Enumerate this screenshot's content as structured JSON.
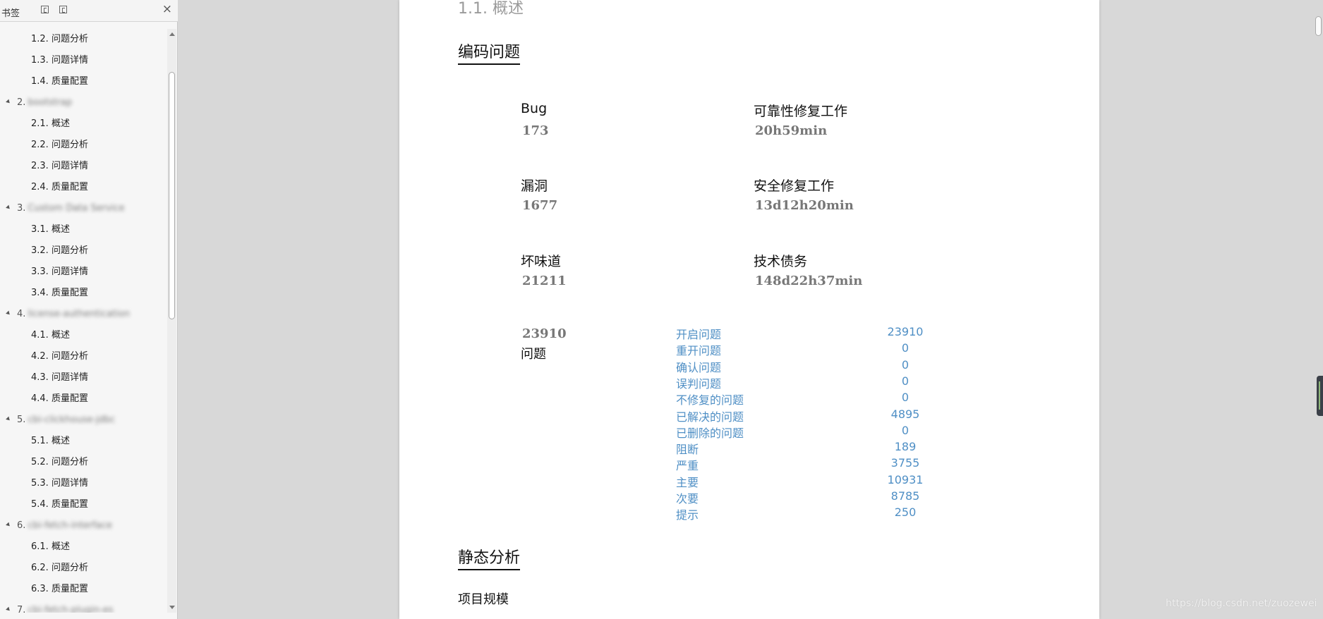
{
  "sidebar": {
    "title": "书签",
    "close_glyph": "×",
    "items": [
      {
        "level": 2,
        "label": "1.2. 问题分析"
      },
      {
        "level": 2,
        "label": "1.3. 问题详情"
      },
      {
        "level": 2,
        "label": "1.4. 质量配置"
      },
      {
        "level": 1,
        "label": "2.",
        "blurred": "bootstrap"
      },
      {
        "level": 2,
        "label": "2.1. 概述"
      },
      {
        "level": 2,
        "label": "2.2. 问题分析"
      },
      {
        "level": 2,
        "label": "2.3. 问题详情"
      },
      {
        "level": 2,
        "label": "2.4. 质量配置"
      },
      {
        "level": 1,
        "label": "3.",
        "blurred": "Custom Data Service"
      },
      {
        "level": 2,
        "label": "3.1. 概述"
      },
      {
        "level": 2,
        "label": "3.2. 问题分析"
      },
      {
        "level": 2,
        "label": "3.3. 问题详情"
      },
      {
        "level": 2,
        "label": "3.4. 质量配置"
      },
      {
        "level": 1,
        "label": "4.",
        "blurred": "license-authentication"
      },
      {
        "level": 2,
        "label": "4.1. 概述"
      },
      {
        "level": 2,
        "label": "4.2. 问题分析"
      },
      {
        "level": 2,
        "label": "4.3. 问题详情"
      },
      {
        "level": 2,
        "label": "4.4. 质量配置"
      },
      {
        "level": 1,
        "label": "5.",
        "blurred": "cbi-clickhouse-jdbc"
      },
      {
        "level": 2,
        "label": "5.1. 概述"
      },
      {
        "level": 2,
        "label": "5.2. 问题分析"
      },
      {
        "level": 2,
        "label": "5.3. 问题详情"
      },
      {
        "level": 2,
        "label": "5.4. 质量配置"
      },
      {
        "level": 1,
        "label": "6.",
        "blurred": "cbi-fetch-interface"
      },
      {
        "level": 2,
        "label": "6.1. 概述"
      },
      {
        "level": 2,
        "label": "6.2. 问题分析"
      },
      {
        "level": 2,
        "label": "6.3. 质量配置"
      },
      {
        "level": 1,
        "label": "7.",
        "blurred": "cbi-fetch-plugin-es"
      }
    ]
  },
  "document": {
    "section_heading": "1.1. 概述",
    "coding_issues_heading": "编码问题",
    "metrics": [
      {
        "label": "Bug",
        "value": "173"
      },
      {
        "label": "可靠性修复工作",
        "value": "20h59min"
      },
      {
        "label": "漏洞",
        "value": "1677"
      },
      {
        "label": "安全修复工作",
        "value": "13d12h20min"
      },
      {
        "label": "坏味道",
        "value": "21211"
      },
      {
        "label": "技术债务",
        "value": "148d22h37min"
      }
    ],
    "total_issues": {
      "value": "23910",
      "label": "问题"
    },
    "breakdown": [
      {
        "label": "开启问题",
        "value": "23910"
      },
      {
        "label": "重开问题",
        "value": "0"
      },
      {
        "label": "确认问题",
        "value": "0"
      },
      {
        "label": "误判问题",
        "value": "0"
      },
      {
        "label": "不修复的问题",
        "value": "0"
      },
      {
        "label": "已解决的问题",
        "value": "4895"
      },
      {
        "label": "已删除的问题",
        "value": "0"
      },
      {
        "label": "阻断",
        "value": "189"
      },
      {
        "label": "严重",
        "value": "3755"
      },
      {
        "label": "主要",
        "value": "10931"
      },
      {
        "label": "次要",
        "value": "8785"
      },
      {
        "label": "提示",
        "value": "250"
      }
    ],
    "static_analysis_heading": "静态分析",
    "project_scale_heading": "项目规模"
  },
  "watermark": "https://blog.csdn.net/zuozewei",
  "colors": {
    "breakdown_text": "#4f8fc5",
    "metric_value": "#777777",
    "app_background": "#d8d8d8"
  }
}
